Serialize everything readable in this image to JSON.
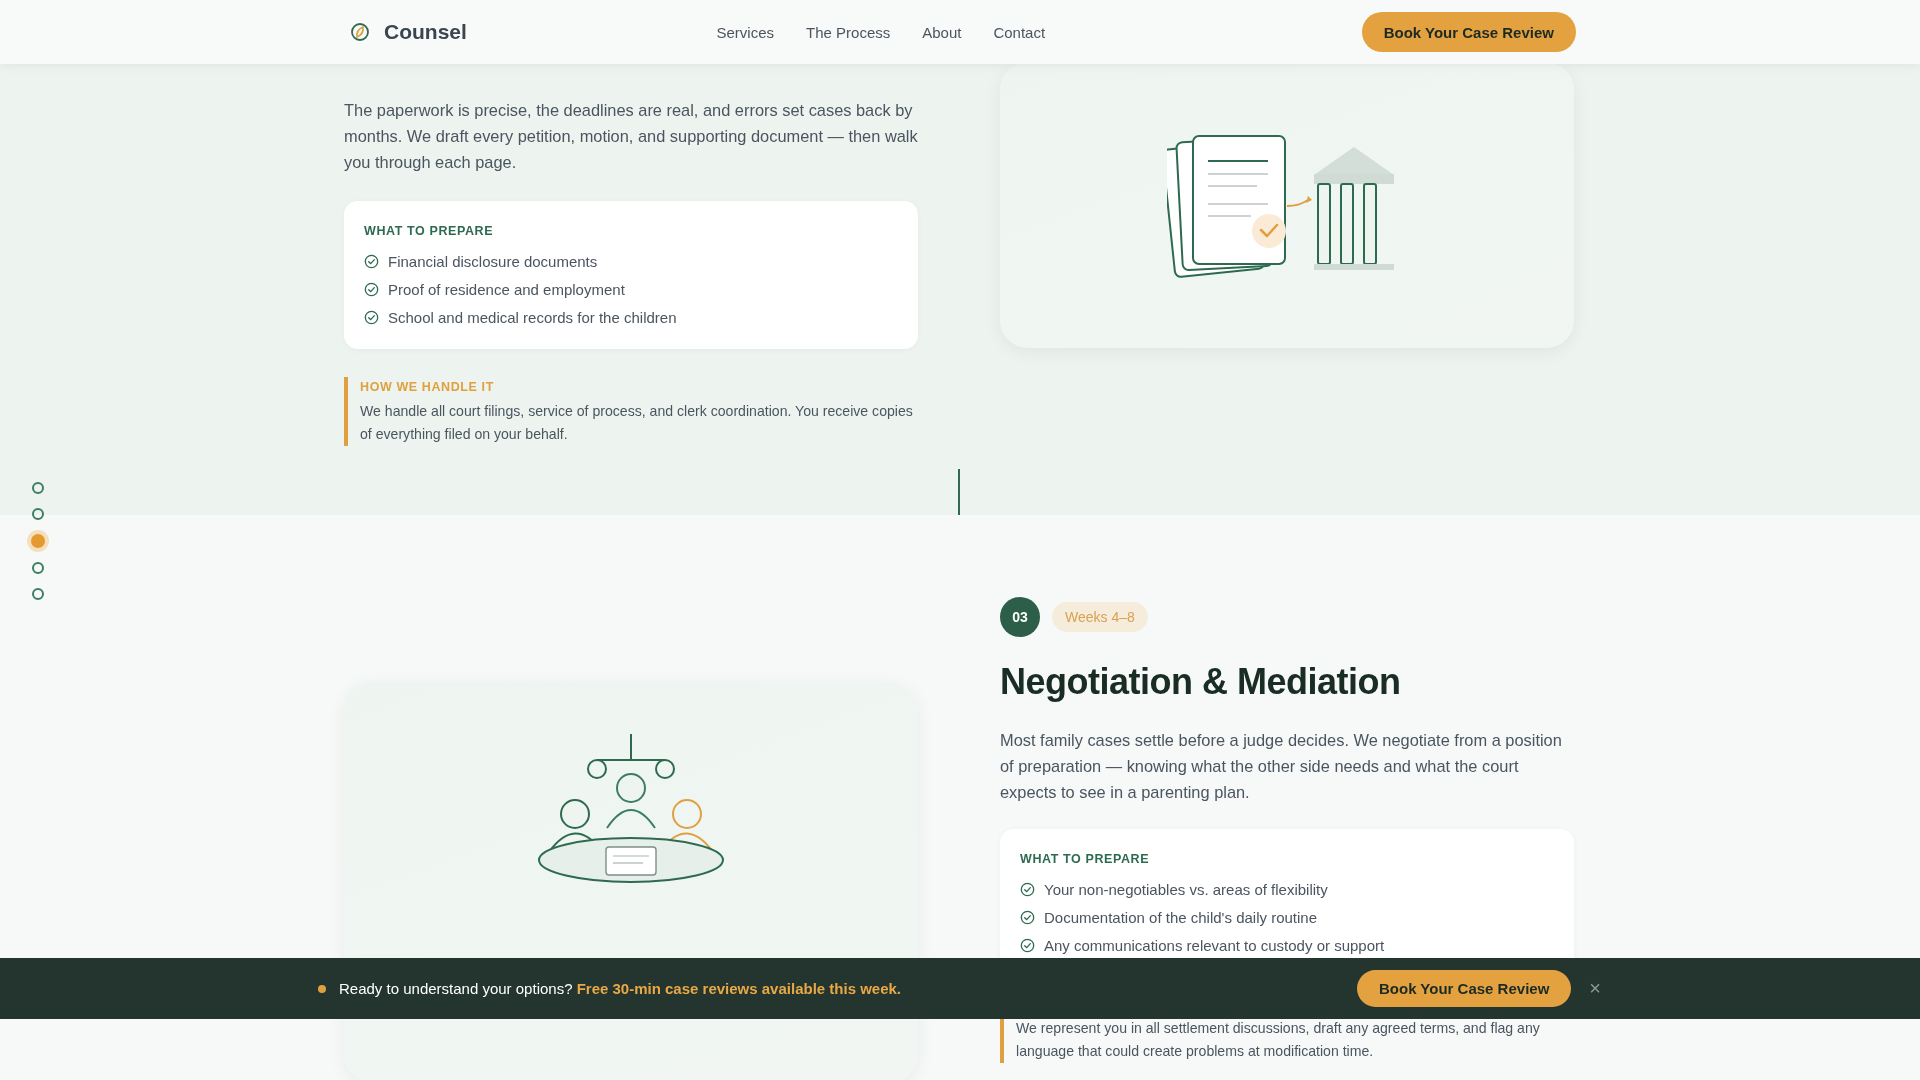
{
  "header": {
    "brand": "Counsel",
    "nav": [
      {
        "label": "Services"
      },
      {
        "label": "The Process"
      },
      {
        "label": "About"
      },
      {
        "label": "Contact"
      }
    ],
    "cta": "Book Your Case Review"
  },
  "section_nav": [
    {
      "selected": false
    },
    {
      "selected": false
    },
    {
      "selected": true
    },
    {
      "selected": false
    },
    {
      "selected": false
    }
  ],
  "steps": [
    {
      "kind": "documents",
      "description": "The paperwork is precise, the deadlines are real, and errors set cases back by months. We draft every petition, motion, and supporting document — then walk you through each page.",
      "prepare": {
        "heading": "WHAT TO PREPARE",
        "items": [
          "Financial disclosure documents",
          "Proof of residence and employment",
          "School and medical records for the children"
        ]
      },
      "handle": {
        "heading": "HOW WE HANDLE IT",
        "text": "We handle all court filings, service of process, and clerk coordination. You receive copies of everything filed on your behalf."
      }
    },
    {
      "kind": "meeting",
      "number": "03",
      "timing": "Weeks 4–8",
      "title": "Negotiation & Mediation",
      "description": "Most family cases settle before a judge decides. We negotiate from a position of preparation — knowing what the other side needs and what the court expects to see in a parenting plan.",
      "prepare": {
        "heading": "WHAT TO PREPARE",
        "items": [
          "Your non-negotiables vs. areas of flexibility",
          "Documentation of the child's daily routine",
          "Any communications relevant to custody or support"
        ]
      },
      "handle": {
        "text": "We represent you in all settlement discussions, draft any agreed terms, and flag any language that could create problems at modification time."
      }
    }
  ],
  "banner": {
    "text": "Ready to understand your options? **Free 30-min case reviews available this week.**",
    "cta": "Book Your Case Review",
    "close": "×"
  }
}
